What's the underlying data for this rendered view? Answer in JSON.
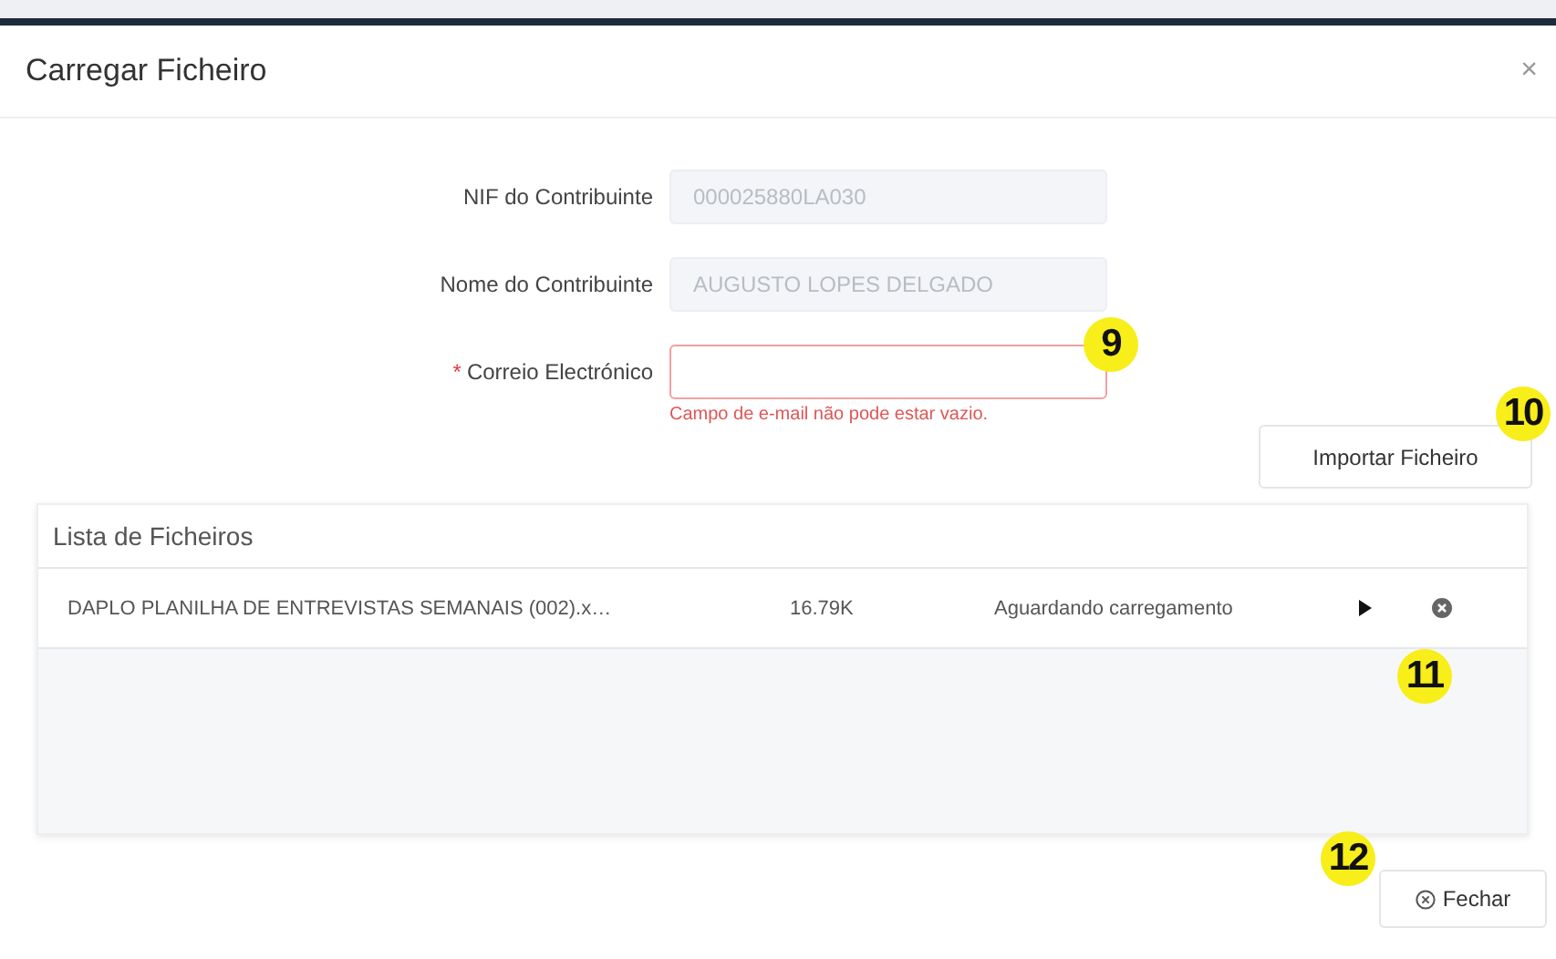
{
  "dialog": {
    "title": "Carregar Ficheiro",
    "close": "×"
  },
  "fields": [
    {
      "label": "NIF do Contribuinte",
      "value": "000025880LA030",
      "disabled": true,
      "required": false
    },
    {
      "label": "Nome do Contribuinte",
      "value": "AUGUSTO LOPES DELGADO",
      "disabled": true,
      "required": false
    },
    {
      "label": "Correio Electrónico",
      "disabled": false,
      "required": true,
      "required_mark": "*",
      "error": "Campo de e-mail não pode estar vazio."
    }
  ],
  "import_button": "Importar Ficheiro",
  "file_list": {
    "title": "Lista de Ficheiros",
    "rows": [
      {
        "name": "DAPLO PLANILHA DE ENTREVISTAS SEMANAIS (002).x…",
        "size": "16.79K",
        "status": "Aguardando carregamento"
      }
    ]
  },
  "close_button": "Fechar",
  "callouts": [
    "9",
    "10",
    "11",
    "12"
  ]
}
